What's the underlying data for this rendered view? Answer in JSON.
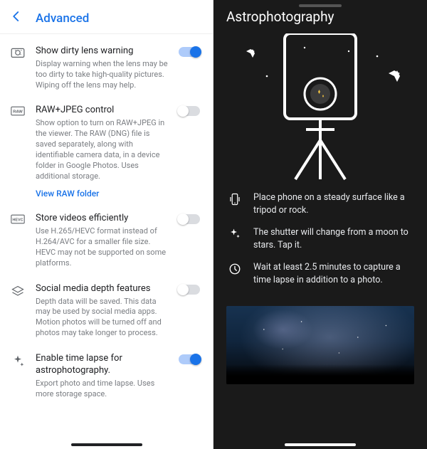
{
  "left": {
    "header": {
      "title": "Advanced"
    },
    "settings": [
      {
        "icon": "dirty-lens-icon",
        "title": "Show dirty lens warning",
        "desc": "Display warning when the lens may be too dirty to take high-quality pictures. Wiping off the lens may help.",
        "toggle": true
      },
      {
        "icon": "raw-icon",
        "title": "RAW+JPEG control",
        "desc": "Show option to turn on RAW+JPEG in the viewer. The RAW (DNG) file is saved separately, along with identifiable camera data, in a device folder in Google Photos. Uses additional storage.",
        "link": "View RAW folder",
        "toggle": false
      },
      {
        "icon": "hevc-icon",
        "title": "Store videos efficiently",
        "desc": "Use H.265/HEVC format instead of H.264/AVC for a smaller file size. HEVC may not be supported on some platforms.",
        "toggle": false
      },
      {
        "icon": "depth-icon",
        "title": "Social media depth features",
        "desc": "Depth data will be saved. This data may be used by social media apps. Motion photos will be turned off and photos may take longer to process.",
        "toggle": false
      },
      {
        "icon": "sparkle-icon",
        "title": "Enable time lapse for astrophotography.",
        "desc": "Export photo and time lapse. Uses more storage space.",
        "toggle": true
      }
    ]
  },
  "right": {
    "header": {
      "title": "Astrophotography"
    },
    "tips": [
      {
        "icon": "phone-icon",
        "text": "Place phone on a steady surface like a tripod or rock."
      },
      {
        "icon": "sparkle-icon",
        "text": "The shutter will change from a moon to stars. Tap it."
      },
      {
        "icon": "timer-icon",
        "text": "Wait at least 2.5 minutes to capture a time lapse in addition to a photo."
      }
    ]
  }
}
